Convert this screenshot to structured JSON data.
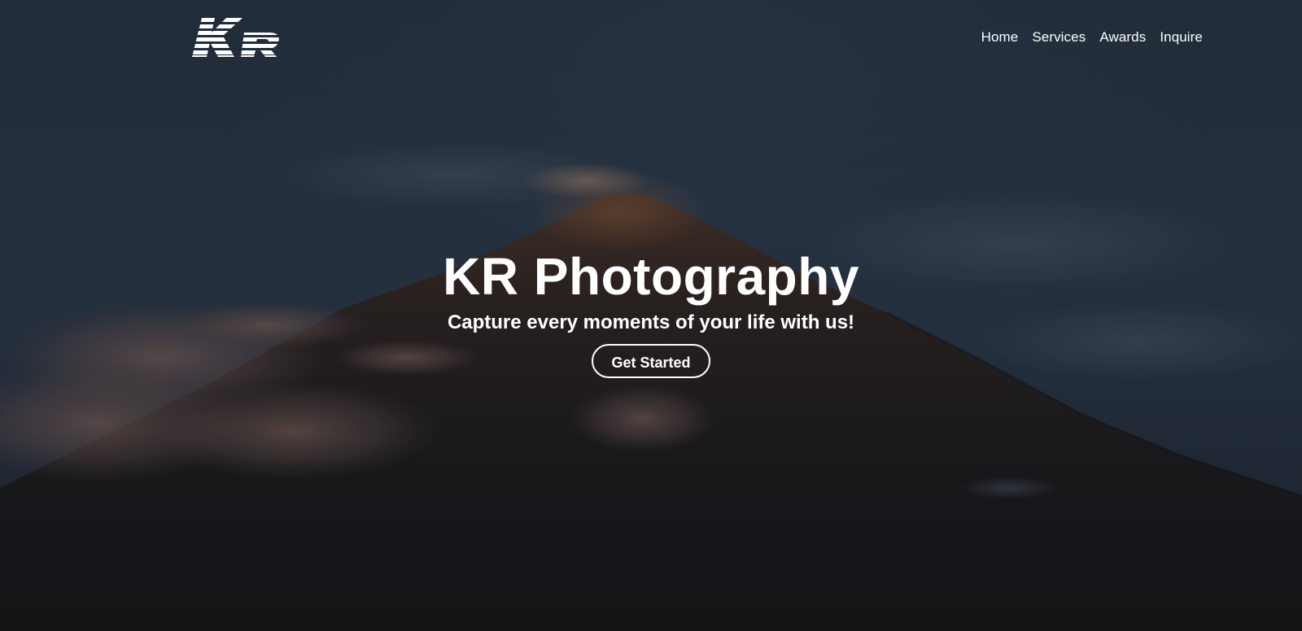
{
  "brand": {
    "logo_text": "KR"
  },
  "nav": {
    "items": [
      {
        "label": "Home"
      },
      {
        "label": "Services"
      },
      {
        "label": "Awards"
      },
      {
        "label": "Inquire"
      }
    ]
  },
  "hero": {
    "title": "KR Photography",
    "subtitle": "Capture every moments of your life with us!",
    "cta_label": "Get Started",
    "background_image": "mountain-peak-with-clouds-at-dusk"
  },
  "colors": {
    "text": "#ffffff",
    "sky": "#2a3545",
    "mountain": "#1d1a1c"
  }
}
